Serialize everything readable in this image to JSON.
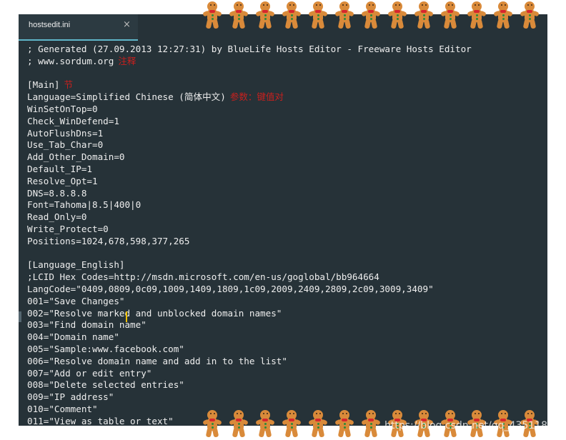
{
  "tab": {
    "title": "hostsedit.ini",
    "close_glyph": "×"
  },
  "annotations": {
    "comment": "注释",
    "section": "节",
    "param": "参数：键值对"
  },
  "lines": [
    "; Generated (27.09.2013 12:27:31) by BlueLife Hosts Editor - Freeware Hosts Editor",
    "; www.sordum.org",
    "",
    "[Main]",
    "Language=Simplified Chinese (简体中文)",
    "WinSetOnTop=0",
    "Check_WinDefend=1",
    "AutoFlushDns=1",
    "Use_Tab_Char=0",
    "Add_Other_Domain=0",
    "Default_IP=1",
    "Resolve_Opt=1",
    "DNS=8.8.8.8",
    "Font=Tahoma|8.5|400|0",
    "Read_Only=0",
    "Write_Protect=0",
    "Positions=1024,678,598,377,265",
    "",
    "[Language_English]",
    ";LCID Hex Codes=http://msdn.microsoft.com/en-us/goglobal/bb964664",
    "LangCode=\"0409,0809,0c09,1009,1409,1809,1c09,2009,2409,2809,2c09,3009,3409\"",
    "001=\"Save Changes\"",
    "002=\"Resolve marked and unblocked domain names\"",
    "003=\"Find domain name\"",
    "004=\"Domain name\"",
    "005=\"Sample:www.facebook.com\"",
    "006=\"Resolve domain name and add in to the list\"",
    "007=\"Add or edit entry\"",
    "008=\"Delete selected entries\"",
    "009=\"IP address\"",
    "010=\"Comment\"",
    "011=\"View as table or text\""
  ],
  "watermark": "https://blog.csdn.net/qq_43511842",
  "colors": {
    "editor_bg": "#263238",
    "text": "#eeeeee",
    "annotation": "#c8201e",
    "cursor": "#f0c000"
  },
  "decoration": {
    "top_count": 13,
    "bottom_count": 13,
    "icon": "gingerbread-man-icon"
  }
}
